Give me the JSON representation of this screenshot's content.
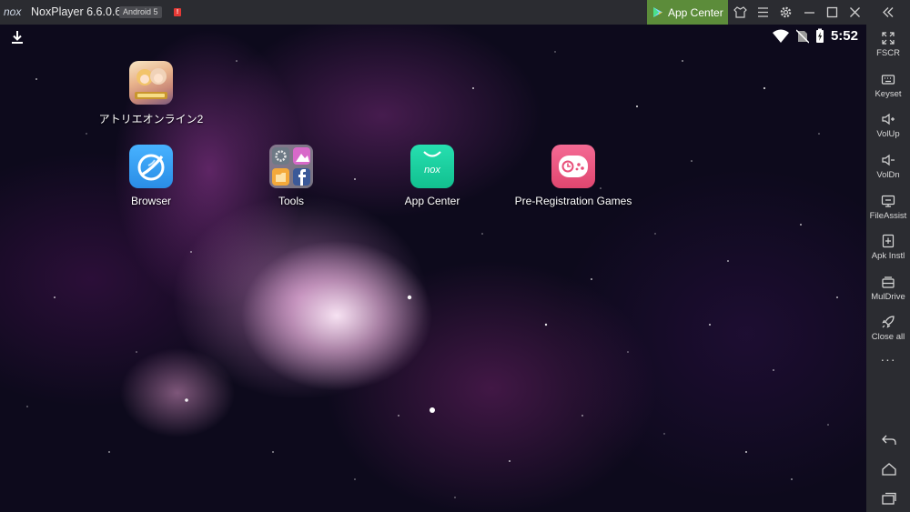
{
  "titlebar": {
    "logo_text": "nox",
    "app_title": "NoxPlayer 6.6.0.6",
    "android_badge": "Android 5",
    "alert_badge": "!",
    "app_center_label": "App Center",
    "icons": [
      "shirt-icon",
      "menu-icon",
      "gear-icon",
      "minimize-icon",
      "maximize-icon",
      "close-icon",
      "collapse-sidebar-icon"
    ]
  },
  "statusbar": {
    "time": "5:52",
    "icons": [
      "download-icon",
      "wifi-icon",
      "no-sim-icon",
      "battery-charging-icon"
    ]
  },
  "apps": [
    {
      "name": "アトリエオンライン2",
      "icon": "atelier-game-icon"
    },
    {
      "name": "Browser",
      "icon": "browser-icon"
    },
    {
      "name": "Tools",
      "icon": "tools-folder-icon"
    },
    {
      "name": "App Center",
      "icon": "app-center-icon",
      "brand_text": "nox"
    },
    {
      "name": "Pre-Registration Games",
      "icon": "gamepad-icon"
    }
  ],
  "sidebar": {
    "items": [
      {
        "label": "FSCR",
        "icon": "fullscreen-icon"
      },
      {
        "label": "Keyset",
        "icon": "keyboard-icon"
      },
      {
        "label": "VolUp",
        "icon": "volume-up-icon"
      },
      {
        "label": "VolDn",
        "icon": "volume-down-icon"
      },
      {
        "label": "FileAssist",
        "icon": "file-assist-icon"
      },
      {
        "label": "Apk Instl",
        "icon": "apk-install-icon"
      },
      {
        "label": "MulDrive",
        "icon": "multi-drive-icon"
      },
      {
        "label": "Close all",
        "icon": "rocket-icon"
      },
      {
        "label": "···",
        "icon": "more-icon"
      }
    ],
    "nav": [
      "back-icon",
      "home-icon",
      "recents-icon"
    ]
  },
  "colors": {
    "chrome": "#2b2c31",
    "app_center_green": "#5c8c3a",
    "browser_blue": "#2e9bf0",
    "app_center_teal": "#1fd4a0",
    "game_pink": "#e84d7c"
  }
}
